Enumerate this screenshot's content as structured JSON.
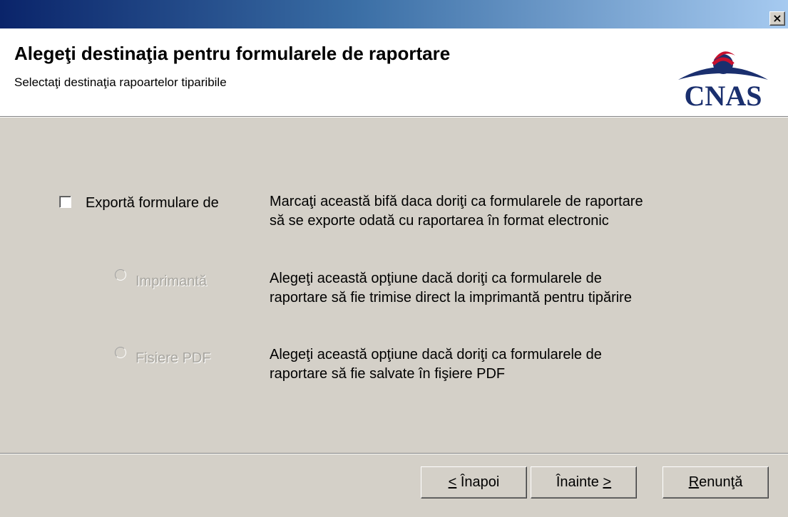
{
  "window": {
    "close_glyph": "×"
  },
  "header": {
    "title": "Alegeţi destinaţia pentru formularele de raportare",
    "subtitle": "Selectaţi destinaţia rapoartelor tiparibile",
    "logo_text": "CNAS"
  },
  "options": {
    "export": {
      "label": "Exportă formulare de",
      "checked": false,
      "description_line1": "Marcaţi această bifă daca doriţi ca formularele de raportare",
      "description_line2": "să se exporte odată cu raportarea în format electronic"
    },
    "printer": {
      "label": "Imprimantă",
      "selected": false,
      "enabled": false,
      "description_line1": "Alegeţi această opţiune dacă doriţi ca formularele de",
      "description_line2": "raportare să fie trimise direct la imprimantă pentru tipărire"
    },
    "pdf": {
      "label": "Fisiere PDF",
      "selected": false,
      "enabled": false,
      "description_line1": "Alegeţi această opţiune dacă doriţi ca formularele de",
      "description_line2": "raportare să fie salvate în fişiere PDF"
    }
  },
  "buttons": {
    "back": {
      "mnemonic": "<",
      "rest": " Înapoi"
    },
    "next": {
      "prefix": "Înainte ",
      "mnemonic": ">"
    },
    "cancel": {
      "mnemonic": "R",
      "rest": "enunţă"
    }
  },
  "colors": {
    "dialog_bg": "#d4d0c8",
    "title_gradient_start": "#0a246a",
    "title_gradient_end": "#a6caf0",
    "logo_blue": "#1a2f6e",
    "logo_red": "#c8102e",
    "disabled_text": "#a8a6a0"
  },
  "icons": {
    "logo": "cnas-logo",
    "close": "close-icon"
  }
}
